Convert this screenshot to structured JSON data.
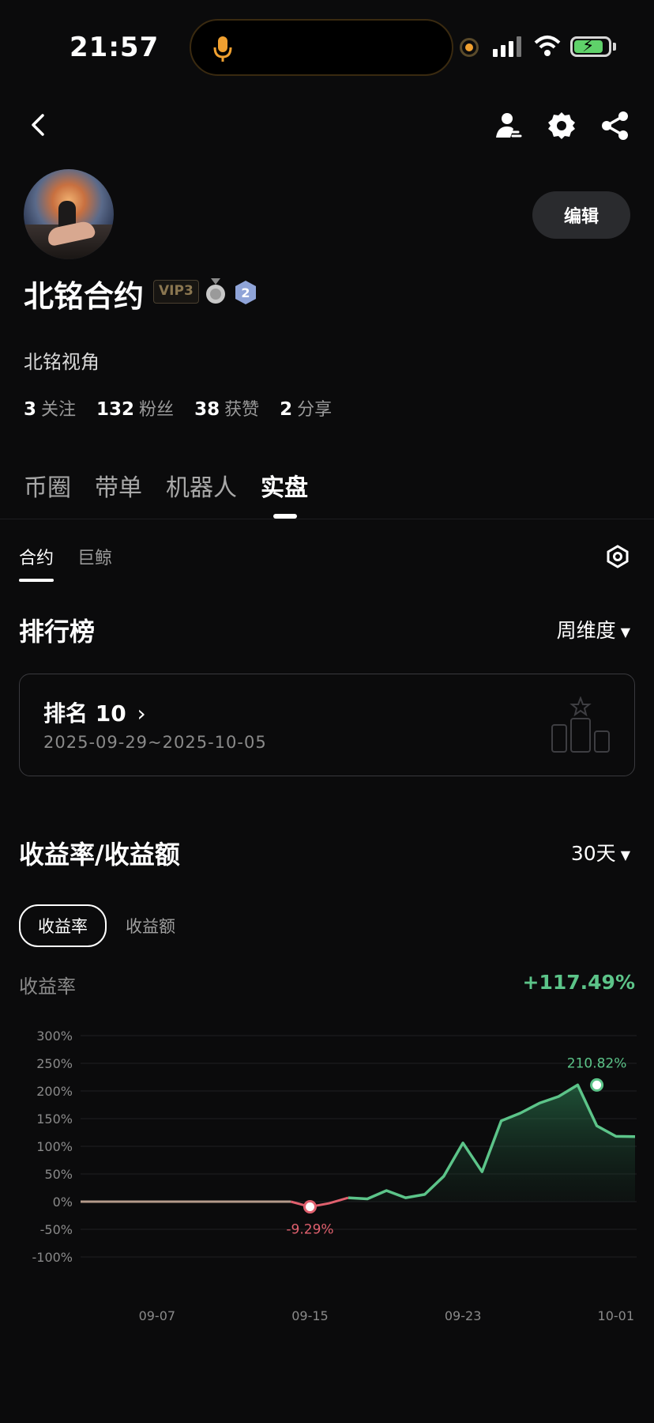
{
  "status_bar": {
    "time": "21:57"
  },
  "profile": {
    "name": "北铭合约",
    "vip_badge": "VIP3",
    "level_badge": "2",
    "bio": "北铭视角",
    "edit_label": "编辑",
    "stats": [
      {
        "num": "3",
        "label": "关注"
      },
      {
        "num": "132",
        "label": "粉丝"
      },
      {
        "num": "38",
        "label": "获赞"
      },
      {
        "num": "2",
        "label": "分享"
      }
    ]
  },
  "main_tabs": [
    "币圈",
    "带单",
    "机器人",
    "实盘"
  ],
  "sub_tabs": [
    "合约",
    "巨鲸"
  ],
  "leaderboard": {
    "title": "排行榜",
    "period": "周维度",
    "rank_label": "排名 10",
    "date_range": "2025-09-29~2025-10-05"
  },
  "returns": {
    "title": "收益率/收益额",
    "period": "30天",
    "toggle": [
      "收益率",
      "收益额"
    ],
    "metric_label": "收益率",
    "metric_value": "+117.49%"
  },
  "colors": {
    "positive": "#5cc489",
    "negative": "#e0606e",
    "accent_dark": "#2a2b2e"
  },
  "chart_data": {
    "type": "area",
    "y_ticks": [
      "300%",
      "250%",
      "200%",
      "150%",
      "100%",
      "50%",
      "0%",
      "-50%",
      "-100%"
    ],
    "ylim": [
      -100,
      300
    ],
    "x_tick_labels": [
      "09-07",
      "09-15",
      "09-23",
      "10-01"
    ],
    "x_tick_days": [
      4,
      12,
      20,
      28
    ],
    "series": [
      {
        "x": [
          0,
          1,
          2,
          3,
          4,
          5,
          6,
          7,
          8,
          9,
          10,
          11,
          12,
          13,
          14,
          15,
          16,
          17,
          18,
          19,
          20,
          21,
          22,
          23,
          24,
          25,
          26,
          27,
          28,
          29
        ],
        "y": [
          0,
          0,
          0,
          0,
          0,
          0,
          0,
          0,
          0,
          0,
          0,
          0,
          -9.29,
          -3,
          7,
          5,
          20,
          7,
          13,
          46,
          106,
          54,
          146,
          160,
          178,
          190,
          210.82,
          137,
          118,
          117.49
        ]
      }
    ],
    "annotations": [
      {
        "x": 12,
        "y": -9.29,
        "label": "-9.29%"
      },
      {
        "x": 27,
        "y": 210.82,
        "label": "210.82%"
      }
    ]
  }
}
